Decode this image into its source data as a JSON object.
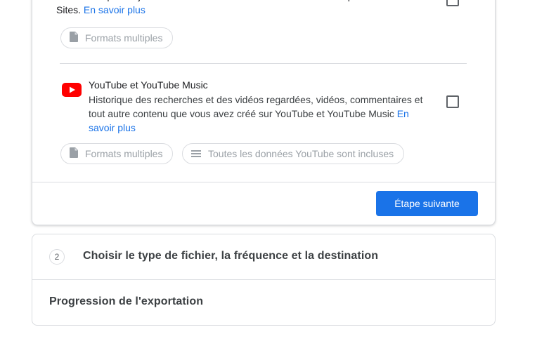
{
  "previous_product": {
    "description_tail": "Contenu et pièces jointes de vos sites créés dans la version classique de Sites.",
    "learn_more": "En savoir plus",
    "formats_chip": "Formats multiples"
  },
  "youtube_product": {
    "title": "YouTube et YouTube Music",
    "description": "Historique des recherches et des vidéos regardées, vidéos, commentaires et tout autre contenu que vous avez créé sur YouTube et YouTube Music",
    "learn_more": "En savoir plus",
    "formats_chip": "Formats multiples",
    "data_chip": "Toutes les données YouTube sont incluses",
    "checked": false
  },
  "actions": {
    "next_step": "Étape suivante"
  },
  "steps": [
    {
      "number": "2",
      "title": "Choisir le type de fichier, la fréquence et la destination"
    }
  ],
  "export_progress": "Progression de l'exportation",
  "colors": {
    "accent": "#1a73e8",
    "youtube_red": "#ff0000",
    "border": "#dadce0",
    "chip_text": "#9aa0a6"
  }
}
